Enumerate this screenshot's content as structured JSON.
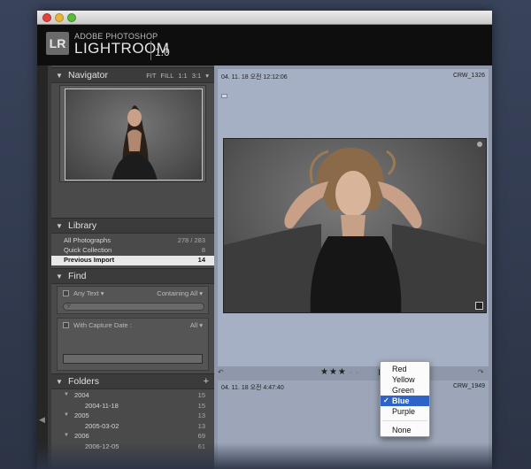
{
  "brand": {
    "logo": "LR",
    "small": "ADOBE PHOTOSHOP",
    "big": "LIGHTROOM",
    "version": "1.0"
  },
  "navigator": {
    "title": "Navigator",
    "options": "FIT FILL 1:1 3:1 ▾"
  },
  "library": {
    "title": "Library",
    "items": [
      {
        "name": "All Photographs",
        "count": "278 / 283"
      },
      {
        "name": "Quick Collection",
        "count": "8"
      },
      {
        "name": "Previous Import",
        "count": "14"
      }
    ]
  },
  "find": {
    "title": "Find",
    "any_text": "Any Text ▾",
    "containing": "Containing All ▾",
    "with_capture": "With Capture Date :",
    "all": "All ▾"
  },
  "folders": {
    "title": "Folders",
    "add": "+",
    "items": [
      {
        "name": "2004",
        "count": "15",
        "level": 0
      },
      {
        "name": "2004-11-18",
        "count": "15",
        "level": 1
      },
      {
        "name": "2005",
        "count": "13",
        "level": 0
      },
      {
        "name": "2005-03-02",
        "count": "13",
        "level": 1
      },
      {
        "name": "2006",
        "count": "69",
        "level": 0
      },
      {
        "name": "2006-12-05",
        "count": "61",
        "level": 1
      }
    ]
  },
  "grid": {
    "cell1": {
      "date": "04. 11. 18 오전 12:12:06",
      "file": "CRW_1326"
    },
    "cell2": {
      "date": "04. 11. 18 오전 4:47:40",
      "file": "CRW_1949"
    },
    "stars": "★★★",
    "star_dots": "· ·"
  },
  "color_menu": {
    "items": [
      "Red",
      "Yellow",
      "Green",
      "Blue",
      "Purple",
      "None"
    ],
    "selected": "Blue",
    "check": "✓"
  },
  "colors": {
    "accent": "#2e63c8",
    "panel": "#4a4a4a",
    "grid_bg": "#8f98aa"
  }
}
